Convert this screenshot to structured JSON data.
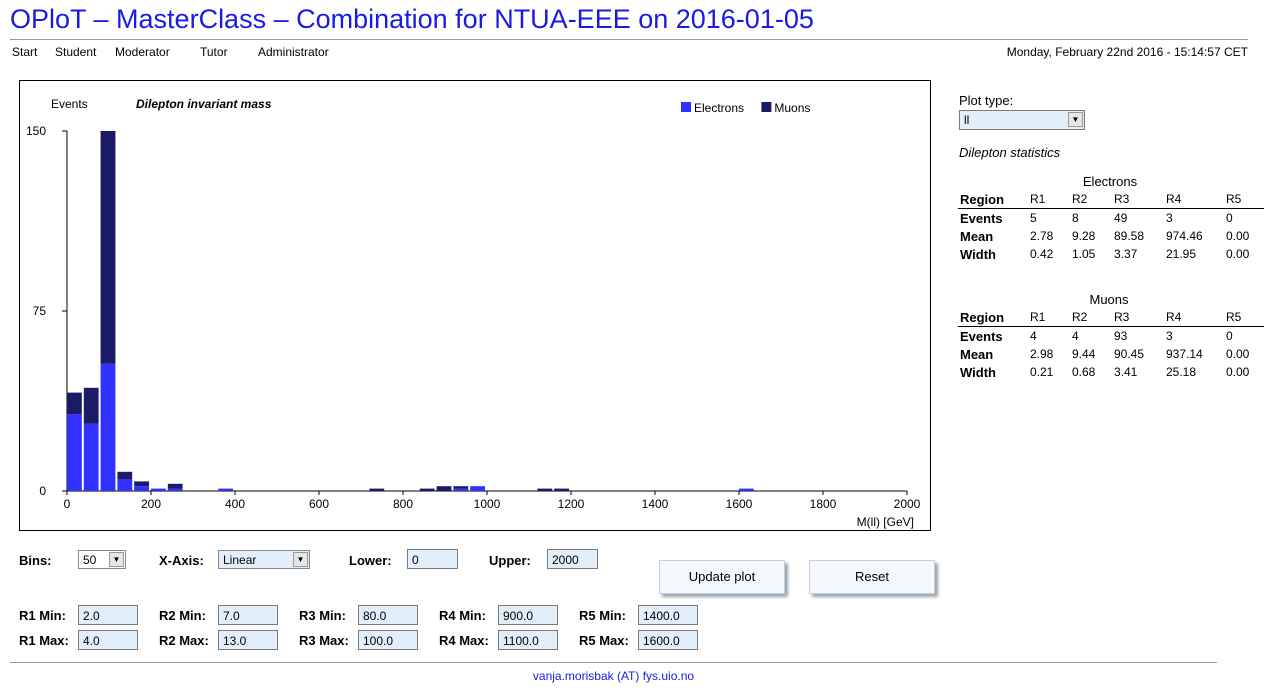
{
  "header": {
    "title": "OPloT – MasterClass – Combination for NTUA-EEE on 2016-01-05",
    "datetime": "Monday, February 22nd 2016 - 15:14:57 CET"
  },
  "nav": [
    "Start",
    "Student",
    "Moderator",
    "Tutor",
    "Administrator"
  ],
  "chart_data": {
    "type": "bar",
    "stacked": true,
    "title": "Dilepton invariant mass",
    "ylabel": "Events",
    "xlabel": "M(ll) [GeV]",
    "xlim": [
      0,
      2000
    ],
    "ylim": [
      0,
      150
    ],
    "bin_width": 40,
    "x_ticks": [
      0,
      200,
      400,
      600,
      800,
      1000,
      1200,
      1400,
      1600,
      1800,
      2000
    ],
    "y_ticks": [
      0,
      75,
      150
    ],
    "legend_position": "top-right",
    "colors": {
      "Electrons": "#3030ff",
      "Muons": "#1a1a66"
    },
    "bin_starts": [
      0,
      40,
      80,
      120,
      160,
      200,
      240,
      360,
      720,
      840,
      880,
      920,
      960,
      1120,
      1160,
      1600
    ],
    "series": [
      {
        "name": "Electrons",
        "values": [
          32,
          28,
          53,
          5,
          2,
          1,
          1,
          1,
          0,
          0,
          0,
          1,
          2,
          0,
          0,
          1
        ]
      },
      {
        "name": "Muons",
        "values": [
          9,
          15,
          97,
          3,
          2,
          0,
          2,
          0,
          1,
          1,
          2,
          1,
          0,
          1,
          1,
          0
        ]
      }
    ]
  },
  "sidebar": {
    "plot_type_label": "Plot type:",
    "plot_type_value": "ll",
    "stats_title": "Dilepton statistics",
    "tables": [
      {
        "group": "Electrons",
        "header": [
          "Region",
          "R1",
          "R2",
          "R3",
          "R4",
          "R5"
        ],
        "rows": [
          [
            "Events",
            "5",
            "8",
            "49",
            "3",
            "0"
          ],
          [
            "Mean",
            "2.78",
            "9.28",
            "89.58",
            "974.46",
            "0.00"
          ],
          [
            "Width",
            "0.42",
            "1.05",
            "3.37",
            "21.95",
            "0.00"
          ]
        ]
      },
      {
        "group": "Muons",
        "header": [
          "Region",
          "R1",
          "R2",
          "R3",
          "R4",
          "R5"
        ],
        "rows": [
          [
            "Events",
            "4",
            "4",
            "93",
            "3",
            "0"
          ],
          [
            "Mean",
            "2.98",
            "9.44",
            "90.45",
            "937.14",
            "0.00"
          ],
          [
            "Width",
            "0.21",
            "0.68",
            "3.41",
            "25.18",
            "0.00"
          ]
        ]
      }
    ]
  },
  "controls": {
    "bins_label": "Bins:",
    "bins_value": "50",
    "xaxis_label": "X-Axis:",
    "xaxis_value": "Linear",
    "lower_label": "Lower:",
    "lower_value": "0",
    "upper_label": "Upper:",
    "upper_value": "2000",
    "update_button": "Update plot",
    "reset_button": "Reset"
  },
  "regions": [
    {
      "min_label": "R1 Min:",
      "min": "2.0",
      "max_label": "R1 Max:",
      "max": "4.0"
    },
    {
      "min_label": "R2 Min:",
      "min": "7.0",
      "max_label": "R2 Max:",
      "max": "13.0"
    },
    {
      "min_label": "R3 Min:",
      "min": "80.0",
      "max_label": "R3 Max:",
      "max": "100.0"
    },
    {
      "min_label": "R4 Min:",
      "min": "900.0",
      "max_label": "R4 Max:",
      "max": "1100.0"
    },
    {
      "min_label": "R5 Min:",
      "min": "1400.0",
      "max_label": "R5 Max:",
      "max": "1600.0"
    }
  ],
  "footer": {
    "contact": "vanja.morisbak (AT) fys.uio.no"
  }
}
